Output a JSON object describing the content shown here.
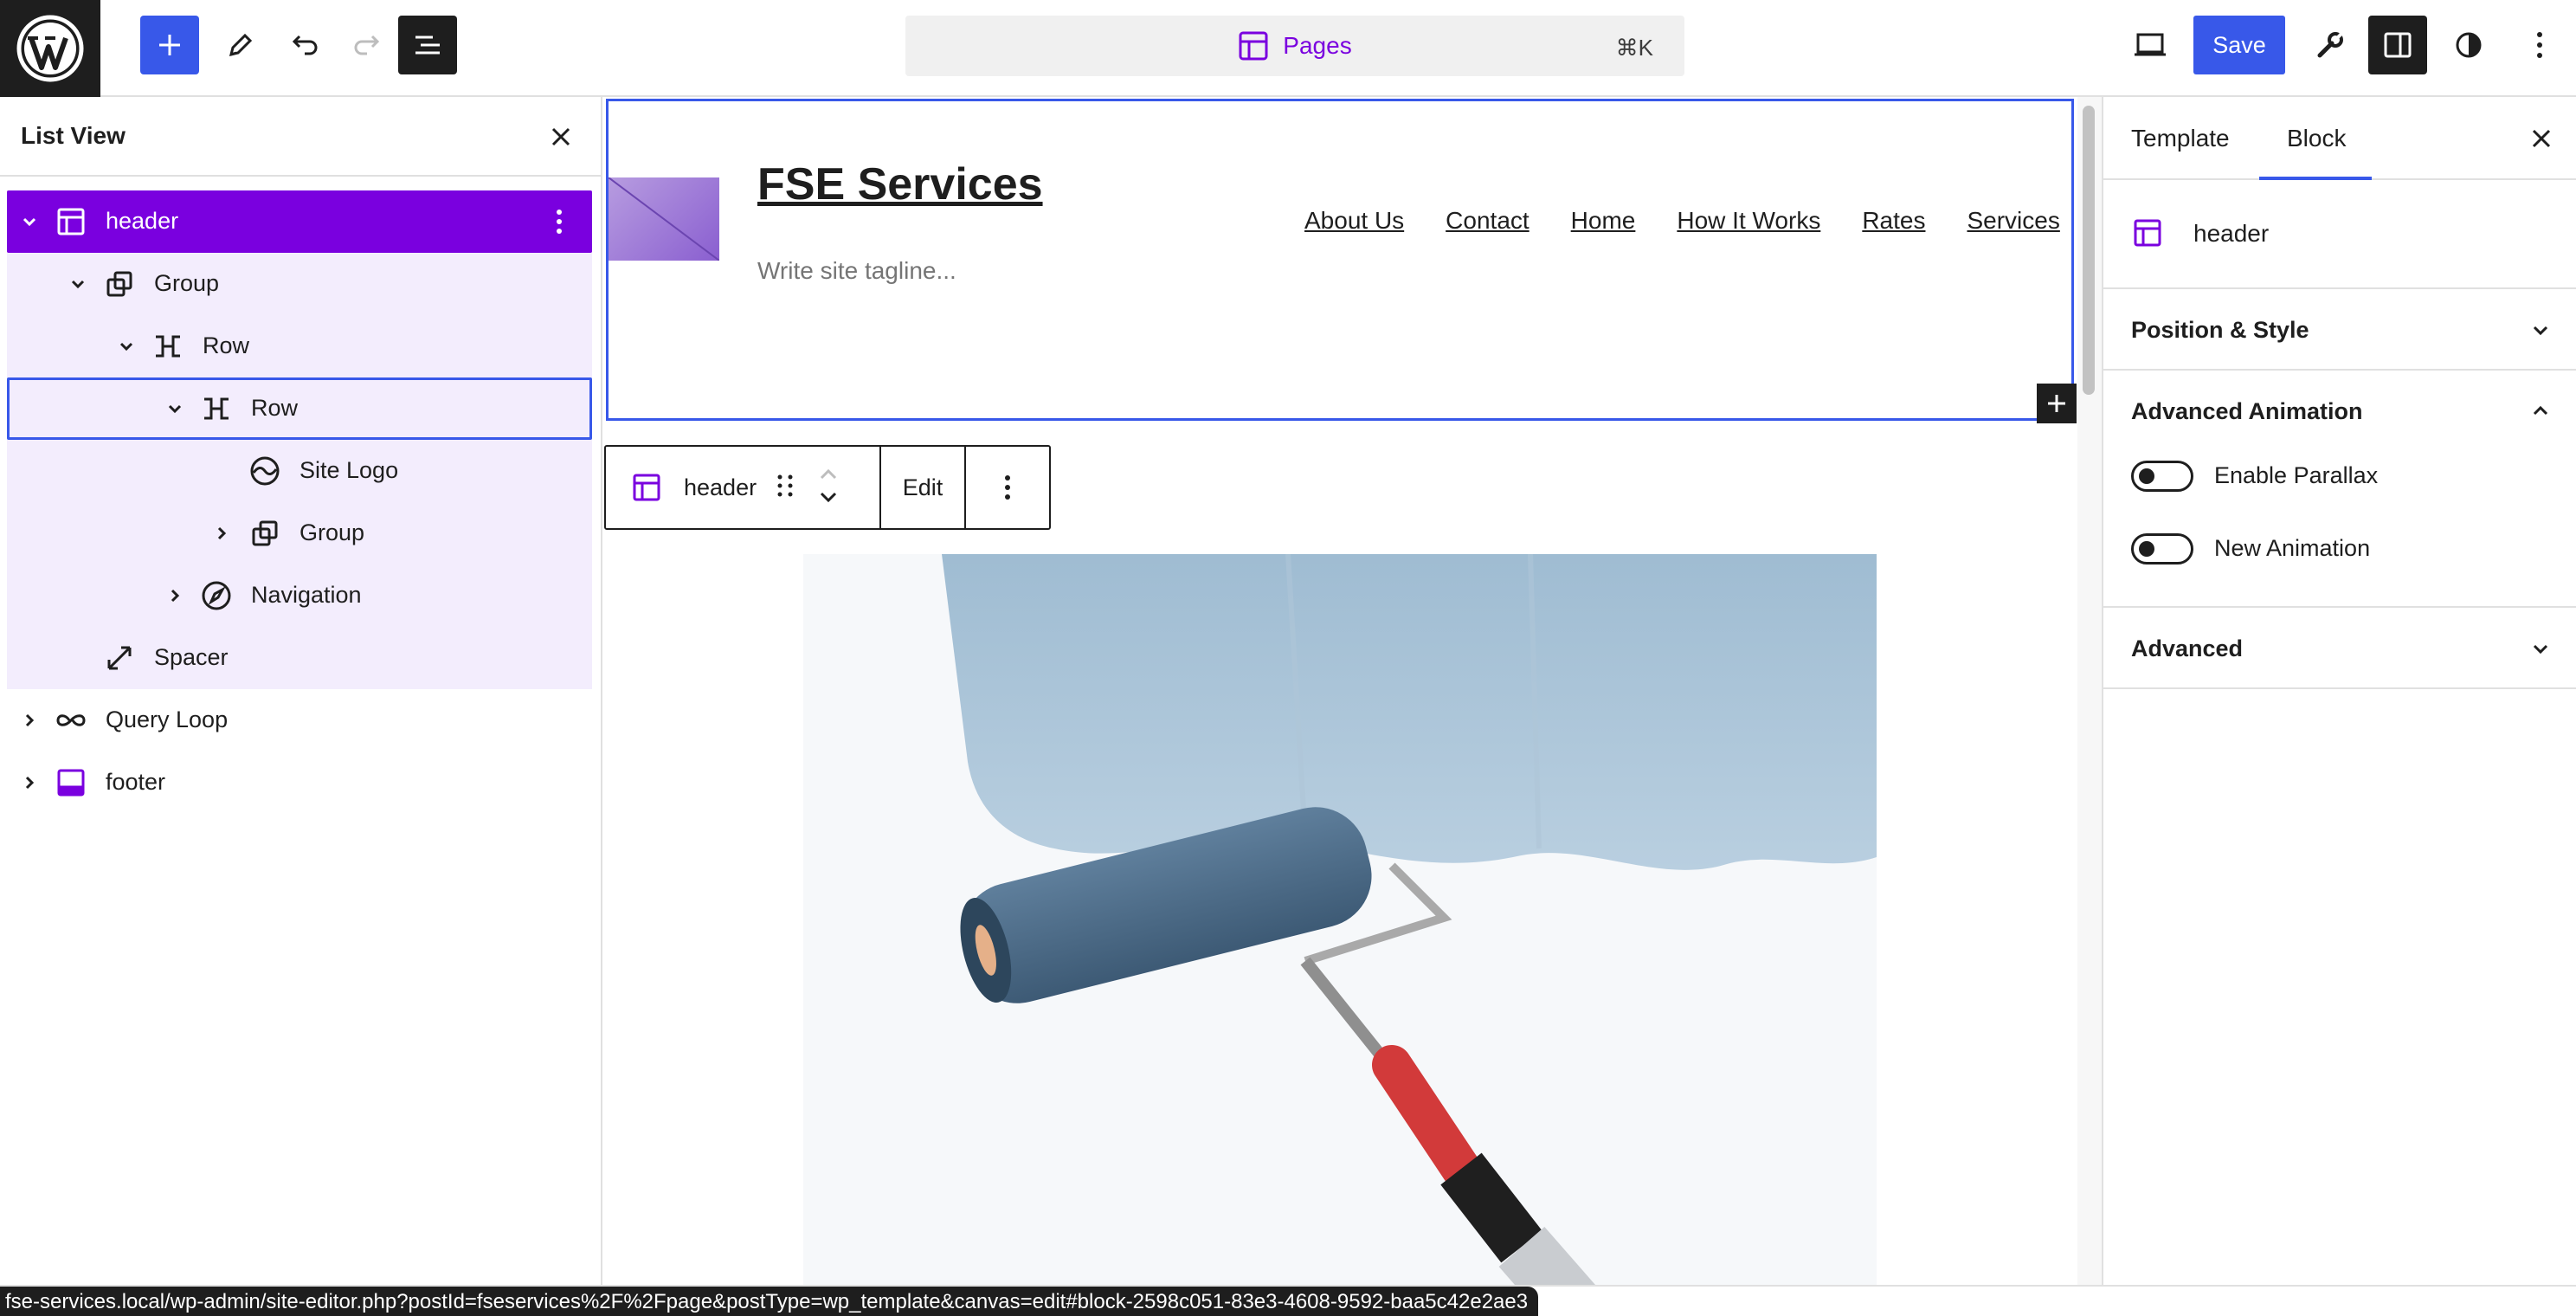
{
  "topbar": {
    "command": {
      "title": "Pages",
      "shortcut": "⌘K"
    },
    "save_label": "Save"
  },
  "listview": {
    "title": "List View",
    "items": [
      {
        "label": "header",
        "depth": 0,
        "expanded": true,
        "icon": "template-part-icon",
        "state": "selected"
      },
      {
        "label": "Group",
        "depth": 1,
        "expanded": true,
        "icon": "group-icon"
      },
      {
        "label": "Row",
        "depth": 2,
        "expanded": true,
        "icon": "row-icon"
      },
      {
        "label": "Row",
        "depth": 3,
        "expanded": true,
        "icon": "row-icon",
        "state": "focused"
      },
      {
        "label": "Site Logo",
        "depth": 4,
        "icon": "site-logo-icon"
      },
      {
        "label": "Group",
        "depth": 4,
        "expanded": false,
        "icon": "group-icon"
      },
      {
        "label": "Navigation",
        "depth": 3,
        "expanded": false,
        "icon": "navigation-icon"
      },
      {
        "label": "Spacer",
        "depth": 1,
        "icon": "spacer-icon"
      },
      {
        "label": "Query Loop",
        "depth": 0,
        "expanded": false,
        "icon": "query-loop-icon"
      },
      {
        "label": "footer",
        "depth": 0,
        "expanded": false,
        "icon": "template-part-icon"
      }
    ]
  },
  "canvas": {
    "site_title": "FSE Services",
    "site_tagline": "Write site tagline...",
    "nav_items": [
      "About Us",
      "Contact",
      "Home",
      "How It Works",
      "Rates",
      "Services"
    ],
    "block_toolbar": {
      "block_name": "header",
      "edit_label": "Edit"
    }
  },
  "sidebar": {
    "tabs": [
      "Template",
      "Block"
    ],
    "active_tab": "Block",
    "block_name": "header",
    "sections": {
      "position_style": "Position & Style",
      "advanced_animation": "Advanced Animation",
      "advanced": "Advanced"
    },
    "toggles": [
      {
        "label": "Enable Parallax",
        "on": false
      },
      {
        "label": "New Animation",
        "on": false
      }
    ]
  },
  "status_url": "fse-services.local/wp-admin/site-editor.php?postId=fseservices%2F%2Fpage&postType=wp_template&canvas=edit#block-2598c051-83e3-4608-9592-baa5c42e2ae3",
  "colors": {
    "accent": "#3858e9",
    "selection": "#7a00df",
    "selection_bg": "#f3edfd",
    "dark": "#1e1e1e"
  }
}
